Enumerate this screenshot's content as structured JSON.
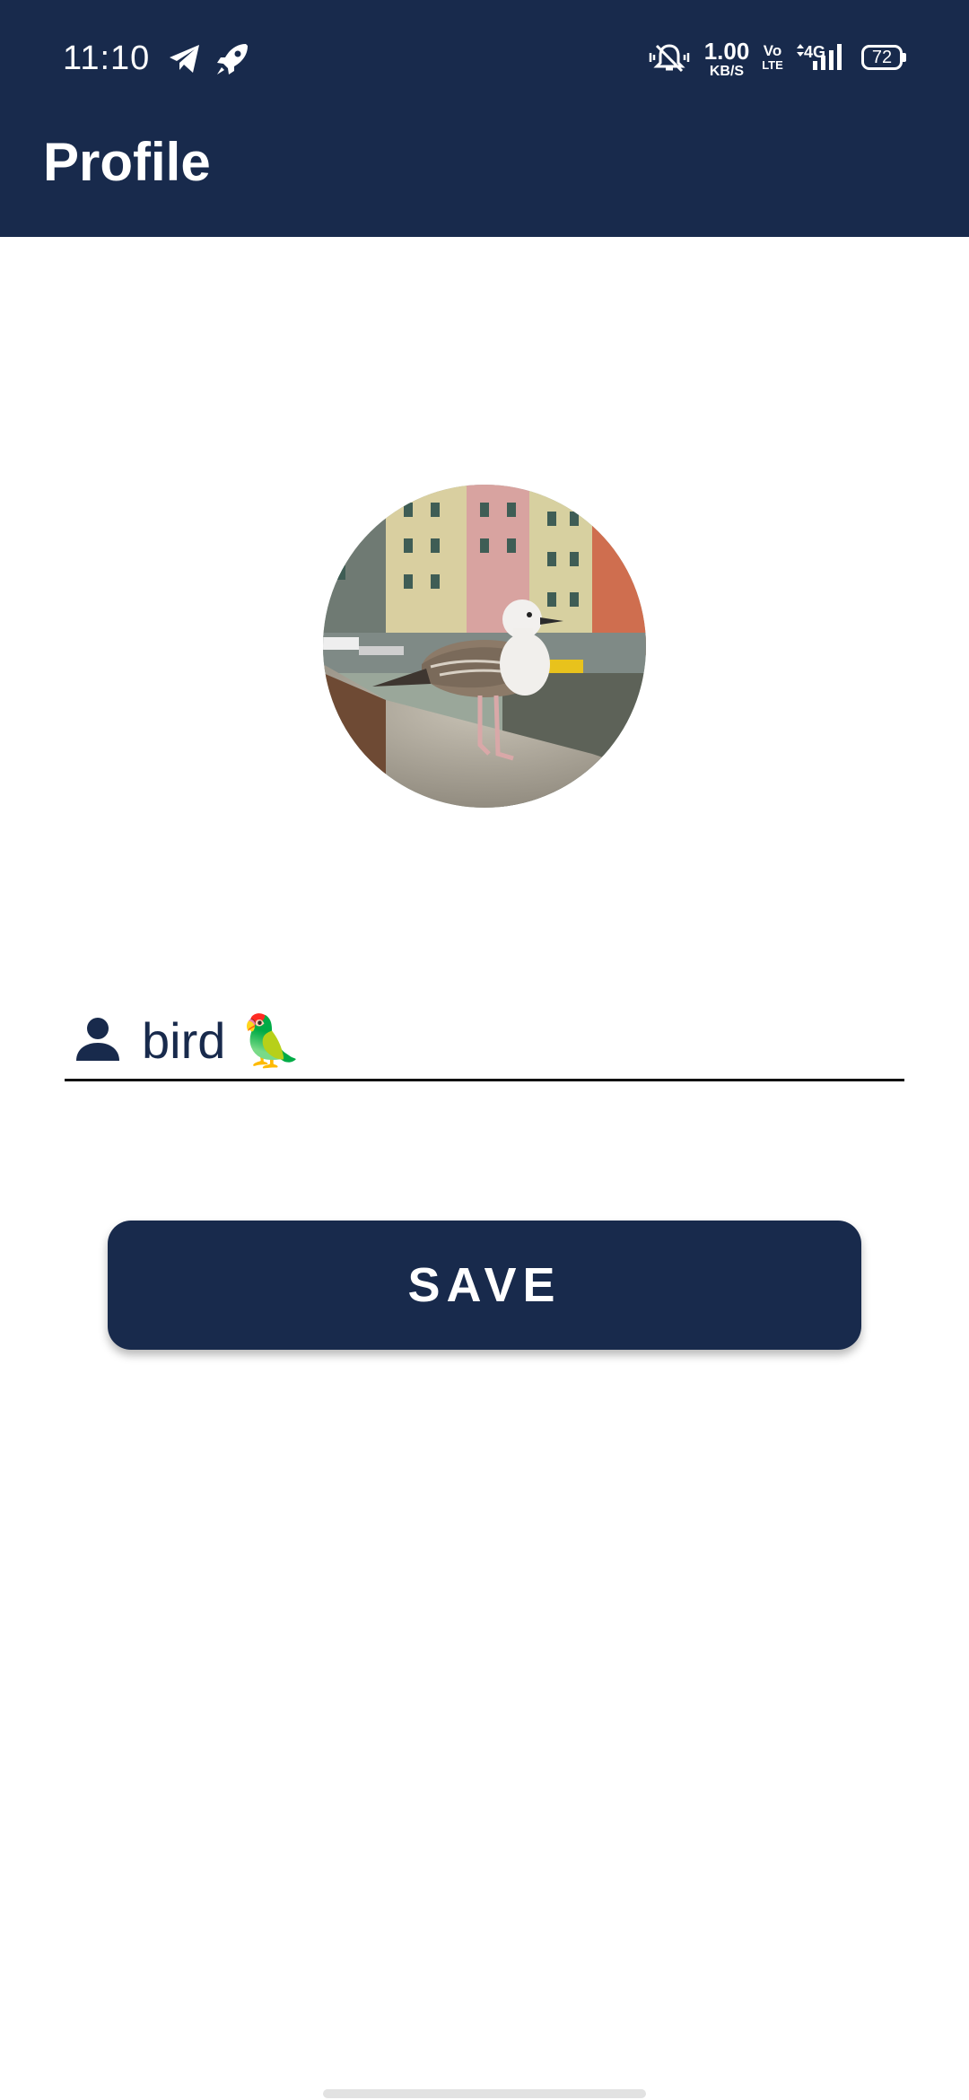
{
  "status_bar": {
    "time": "11:10",
    "speed_value": "1.00",
    "speed_unit": "KB/S",
    "volte_top": "Vo",
    "volte_bottom": "LTE",
    "network_type": "4G",
    "battery_level": "72",
    "icons": [
      "telegram-icon",
      "rocket-icon",
      "mute-bell-icon",
      "signal-icon"
    ]
  },
  "app_bar": {
    "title": "Profile"
  },
  "profile": {
    "avatar_icon": "seagull-photo",
    "name_icon": "person-icon",
    "name_value": "bird 🦜"
  },
  "actions": {
    "save_label": "SAVE"
  },
  "colors": {
    "primary": "#182a4c",
    "background": "#ffffff"
  }
}
